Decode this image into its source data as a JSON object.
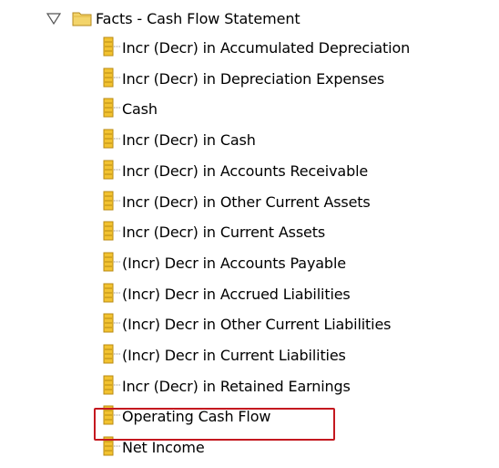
{
  "tree": {
    "folder": {
      "label": "Facts - Cash Flow Statement",
      "expanded": true,
      "icon": "folder-icon"
    },
    "items": [
      {
        "label": "Incr (Decr) in Accumulated Depreciation",
        "icon": "measure-column-icon"
      },
      {
        "label": "Incr (Decr) in Depreciation Expenses",
        "icon": "measure-column-icon"
      },
      {
        "label": "Cash",
        "icon": "measure-column-icon"
      },
      {
        "label": "Incr (Decr) in Cash",
        "icon": "measure-column-icon"
      },
      {
        "label": "Incr (Decr) in Accounts Receivable",
        "icon": "measure-column-icon"
      },
      {
        "label": "Incr (Decr) in Other Current Assets",
        "icon": "measure-column-icon"
      },
      {
        "label": "Incr (Decr) in Current Assets",
        "icon": "measure-column-icon"
      },
      {
        "label": "(Incr) Decr in Accounts Payable",
        "icon": "measure-column-icon"
      },
      {
        "label": "(Incr) Decr in Accrued Liabilities",
        "icon": "measure-column-icon"
      },
      {
        "label": "(Incr) Decr in Other Current Liabilities",
        "icon": "measure-column-icon"
      },
      {
        "label": "(Incr) Decr in Current Liabilities",
        "icon": "measure-column-icon"
      },
      {
        "label": "Incr (Decr) in Retained Earnings",
        "icon": "measure-column-icon"
      },
      {
        "label": "Operating Cash Flow",
        "icon": "measure-column-icon",
        "highlighted": true
      },
      {
        "label": "Net Income",
        "icon": "measure-column-icon"
      }
    ]
  },
  "colors": {
    "highlight_border": "#c4181f",
    "folder_fill": "#f3d46a",
    "column_icon_fill": "#f2c230"
  }
}
